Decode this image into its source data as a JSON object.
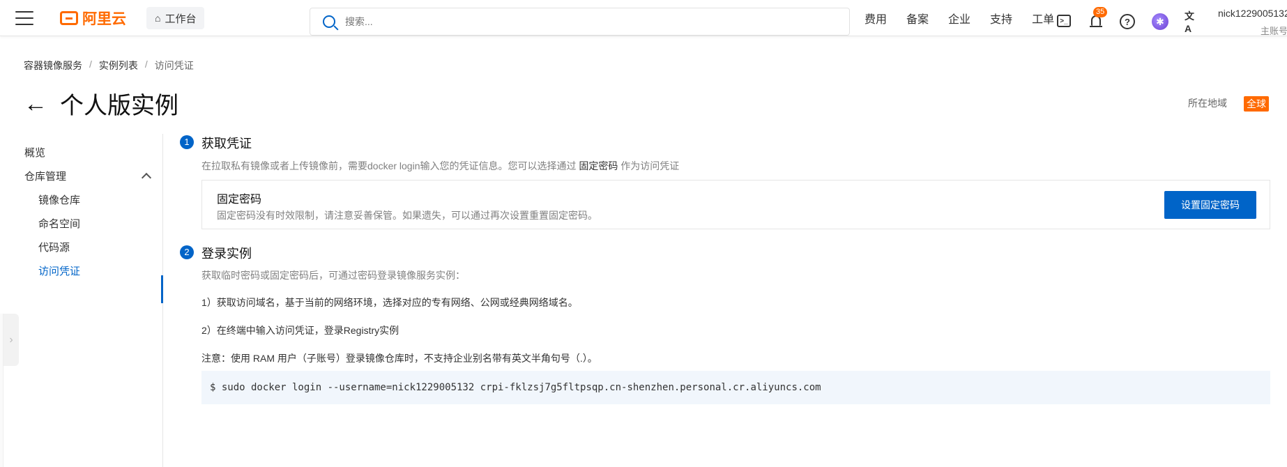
{
  "topbar": {
    "logo_text": "阿里云",
    "workbench_label": "工作台",
    "search_placeholder": "搜索...",
    "nav_links": [
      "费用",
      "备案",
      "企业",
      "支持",
      "工单"
    ],
    "notification_count": "35",
    "user_name": "nick1229005132",
    "user_role": "主账号"
  },
  "breadcrumb": {
    "items": [
      "容器镜像服务",
      "实例列表",
      "访问凭证"
    ],
    "separator": "/"
  },
  "page": {
    "title": "个人版实例",
    "region_label": "所在地域",
    "region_value": "全球"
  },
  "leftnav": {
    "overview": "概览",
    "repo_management": "仓库管理",
    "sub_items": [
      "镜像仓库",
      "命名空间",
      "代码源",
      "访问凭证"
    ],
    "active_item": "访问凭证"
  },
  "step1": {
    "number": "1",
    "title": "获取凭证",
    "desc_before": "在拉取私有镜像或者上传镜像前，需要docker login输入您的凭证信息。您可以选择通过",
    "desc_link": "固定密码",
    "desc_after": "作为访问凭证",
    "card_title": "固定密码",
    "card_desc": "固定密码没有时效限制，请注意妥善保管。如果遗失，可以通过再次设置重置固定密码。",
    "button_label": "设置固定密码"
  },
  "step2": {
    "number": "2",
    "title": "登录实例",
    "desc": "获取临时密码或固定密码后，可通过密码登录镜像服务实例：",
    "line1": "1）获取访问域名，基于当前的网络环境，选择对应的专有网络、公网或经典网络域名。",
    "line2": "2）在终端中输入访问凭证，登录Registry实例",
    "note": "注意：使用 RAM 用户（子账号）登录镜像仓库时，不支持企业别名带有英文半角句号（.）。",
    "command": "$ sudo docker login --username=nick1229005132 crpi-fklzsj7g5fltpsqp.cn-shenzhen.personal.cr.aliyuncs.com"
  },
  "colors": {
    "brand_orange": "#ff6a00",
    "primary_blue": "#0064c8"
  }
}
